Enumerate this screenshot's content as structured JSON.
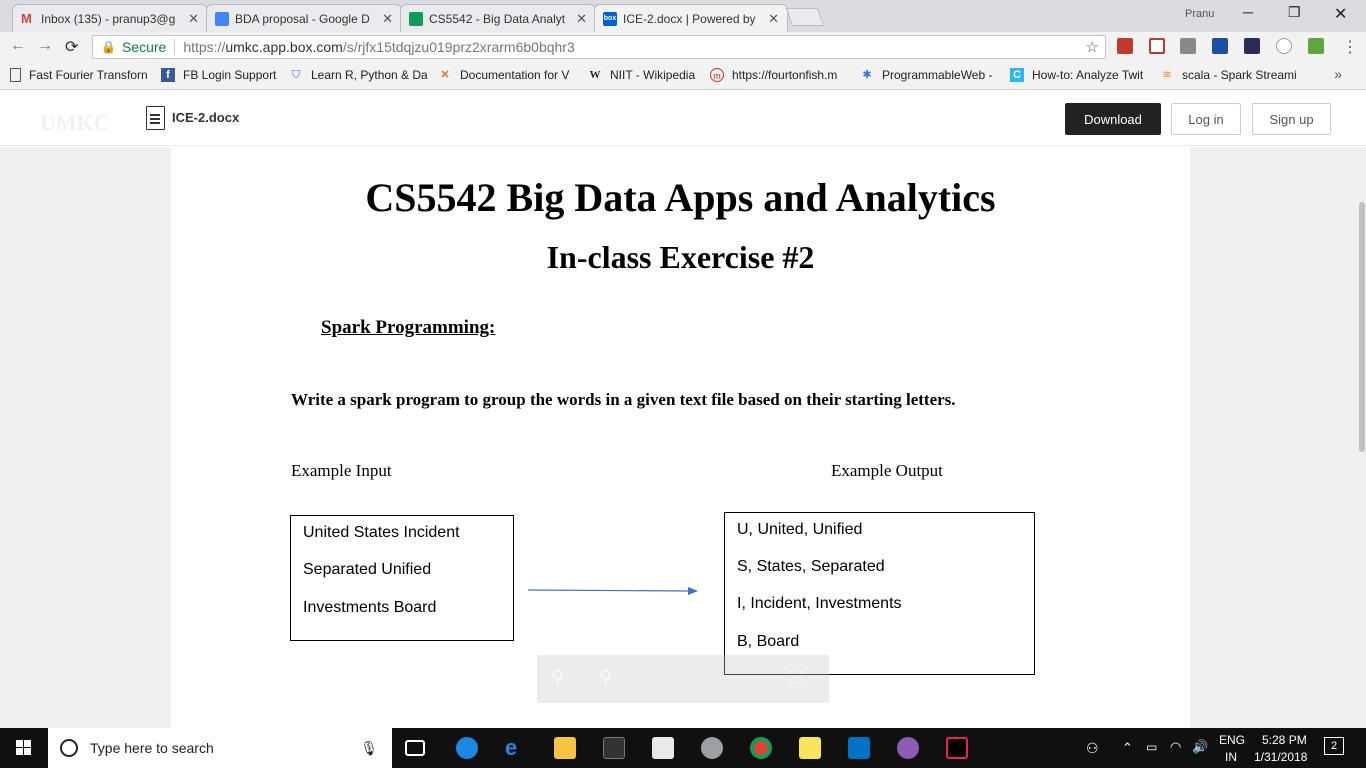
{
  "browser": {
    "tabs": [
      {
        "title": "Inbox (135) - pranup3@g",
        "color": "#d44638"
      },
      {
        "title": "BDA proposal - Google D",
        "color": "#4285f4"
      },
      {
        "title": "CS5542 - Big Data Analyt",
        "color": "#0f9d58"
      },
      {
        "title": "ICE-2.docx | Powered by",
        "color": "#0061d5"
      }
    ],
    "user": "Pranu",
    "secure_label": "Secure",
    "url_prefix": "https://",
    "url_host": "umkc.app.box.com",
    "url_path": "/s/rjfx15tdqjzu019prz2xrarm6b0bqhr3",
    "bookmarks": [
      "Fast Fourier Transforn",
      "FB Login Support",
      "Learn R, Python & Da",
      "Documentation for V",
      "NIIT - Wikipedia",
      "https://fourtonfish.m",
      "ProgrammableWeb -",
      "How-to: Analyze Twit",
      "scala - Spark Streami"
    ],
    "more": "»"
  },
  "box": {
    "logo": "UMKC",
    "filename": "ICE-2.docx",
    "download_label": "Download",
    "login_label": "Log in",
    "signup_label": "Sign up"
  },
  "document": {
    "title": "CS5542 Big Data Apps and Analytics",
    "subtitle": "In-class Exercise #2",
    "section": "Spark Programming:",
    "task": "Write a spark program to group the words in a given text file based on their starting letters.",
    "input_label": "Example Input",
    "output_label": "Example Output",
    "input_lines": [
      "United States Incident",
      "Separated Unified",
      "Investments Board"
    ],
    "output_lines": [
      "U, United, Unified",
      "S, States, Separated",
      "I, Incident, Investments",
      "B, Board"
    ]
  },
  "taskbar": {
    "search_placeholder": "Type here to search",
    "lang_top": "ENG",
    "lang_bottom": "IN",
    "time": "5:28 PM",
    "date": "1/31/2018",
    "notifications": "2"
  }
}
